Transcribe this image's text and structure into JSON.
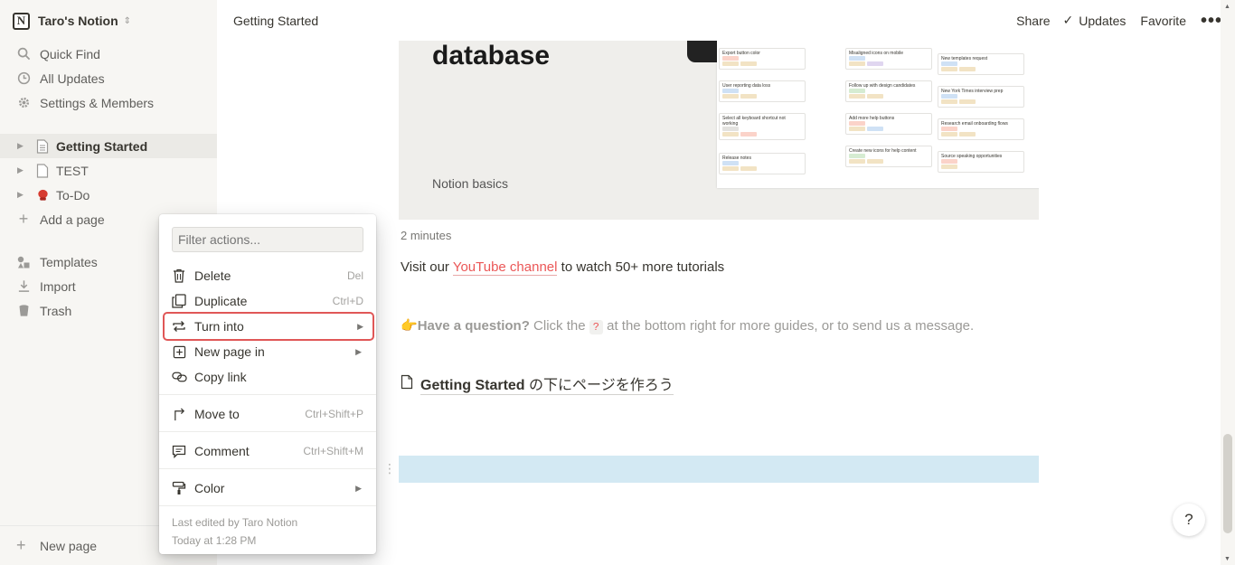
{
  "workspace": {
    "name": "Taro's Notion"
  },
  "sidebar": {
    "nav": [
      {
        "label": "Quick Find",
        "icon": "search-icon"
      },
      {
        "label": "All Updates",
        "icon": "clock-icon"
      },
      {
        "label": "Settings & Members",
        "icon": "gear-icon"
      }
    ],
    "pages": [
      {
        "label": "Getting Started",
        "icon": "document-icon",
        "active": true
      },
      {
        "label": "TEST",
        "icon": "document-icon"
      },
      {
        "label": "To-Do",
        "icon": "boxing-glove-icon"
      }
    ],
    "add_page": "Add a page",
    "tools": [
      {
        "label": "Templates",
        "icon": "shapes-icon"
      },
      {
        "label": "Import",
        "icon": "download-icon"
      },
      {
        "label": "Trash",
        "icon": "trash-icon"
      }
    ],
    "new_page": "New page"
  },
  "topbar": {
    "breadcrumb": "Getting Started",
    "share": "Share",
    "updates": "Updates",
    "favorite": "Favorite",
    "more": "•••"
  },
  "content": {
    "video_title": "database",
    "video_subtitle": "Notion basics",
    "duration": "2 minutes",
    "visit_prefix": "Visit our ",
    "visit_link": "YouTube channel",
    "visit_suffix": " to watch 50+ more tutorials",
    "question_bold": "Have a question?",
    "question_mid": " Click the ",
    "question_mark": "?",
    "question_end": " at the bottom right for more guides, or to send us a message.",
    "sublink_bold": "Getting Started",
    "sublink_rest": " の下にページを作ろう",
    "help": "?"
  },
  "board_cards": [
    "Export button color",
    "User reporting data loss",
    "Select all keyboard shortcut not working",
    "Release notes",
    "Misaligned icons on mobile",
    "Follow up with design candidates",
    "Add more help buttons",
    "Create new icons for help content",
    "New templates request",
    "New York Times interview prep",
    "Research email onboarding flows",
    "Source speaking opportunities"
  ],
  "menu": {
    "filter_placeholder": "Filter actions...",
    "items": [
      {
        "label": "Delete",
        "shortcut": "Del",
        "icon": "trash-icon"
      },
      {
        "label": "Duplicate",
        "shortcut": "Ctrl+D",
        "icon": "duplicate-icon"
      },
      {
        "label": "Turn into",
        "icon": "turn-into-icon",
        "submenu": true
      },
      {
        "label": "New page in",
        "icon": "new-page-in-icon",
        "submenu": true
      },
      {
        "label": "Copy link",
        "icon": "link-icon"
      },
      {
        "label": "Move to",
        "shortcut": "Ctrl+Shift+P",
        "icon": "move-arrow-icon"
      },
      {
        "label": "Comment",
        "shortcut": "Ctrl+Shift+M",
        "icon": "comment-icon"
      },
      {
        "label": "Color",
        "icon": "paint-roller-icon",
        "submenu": true
      }
    ],
    "last_edited": "Last edited by Taro Notion",
    "edited_time": "Today at 1:28 PM"
  },
  "colors": {
    "accent_link": "#eb5757",
    "highlight_block": "#d3e9f3",
    "menu_highlight": "#e05757"
  }
}
